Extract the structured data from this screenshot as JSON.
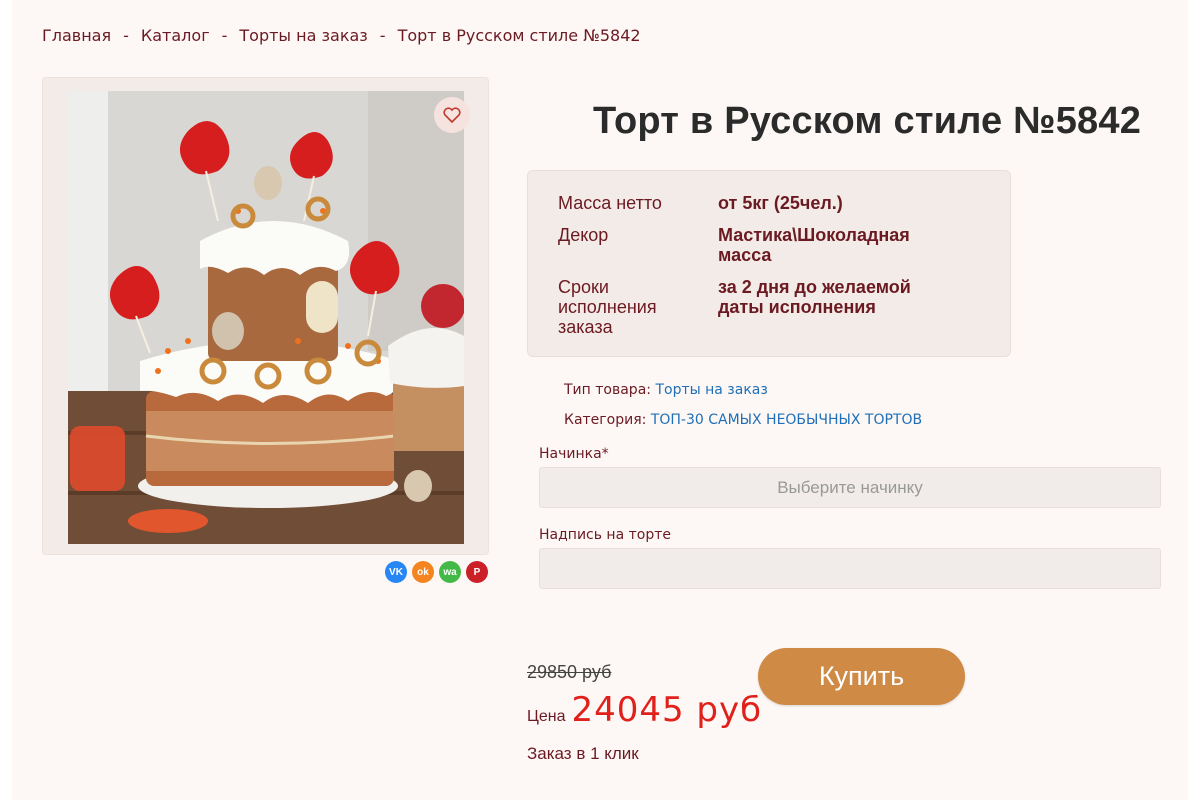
{
  "breadcrumb": {
    "items": [
      "Главная",
      "Каталог",
      "Торты на заказ",
      "Торт в Русском стиле №5842"
    ],
    "separator": "-"
  },
  "product": {
    "title": "Торт в Русском стиле №5842",
    "image_alt": "Торт в Русском стиле",
    "favorite_icon": "heart-icon"
  },
  "specs": [
    {
      "label": "Масса нетто",
      "value": "от 5кг (25чел.)"
    },
    {
      "label": "Декор",
      "value": "Мастика\\Шоколадная масса"
    },
    {
      "label": "Сроки исполнения заказа",
      "value": "за 2 дня до желаемой даты исполнения"
    }
  ],
  "meta": {
    "type_label": "Тип товара:",
    "type_value": "Торты на заказ",
    "category_label": "Категория:",
    "category_value": "ТОП-30 САМЫХ НЕОБЫЧНЫХ ТОРТОВ"
  },
  "form": {
    "filling_label": "Начинка*",
    "filling_placeholder": "Выберите начинку",
    "inscription_label": "Надпись на торте",
    "inscription_value": ""
  },
  "price": {
    "old": "29850 руб",
    "label": "Цена",
    "current": "24045 руб"
  },
  "actions": {
    "buy": "Купить",
    "one_click": "Заказ в 1 клик"
  },
  "share": [
    {
      "icon": "vk-icon",
      "text": "VK",
      "color": "#2787f5"
    },
    {
      "icon": "odnoklassniki-icon",
      "text": "ok",
      "color": "#f48420"
    },
    {
      "icon": "whatsapp-icon",
      "text": "wa",
      "color": "#43b948"
    },
    {
      "icon": "pinterest-icon",
      "text": "P",
      "color": "#cb2027"
    }
  ],
  "colors": {
    "accent": "#6b1a22",
    "price": "#e0211b",
    "button": "#cf8a45",
    "link": "#1f6fb8"
  }
}
